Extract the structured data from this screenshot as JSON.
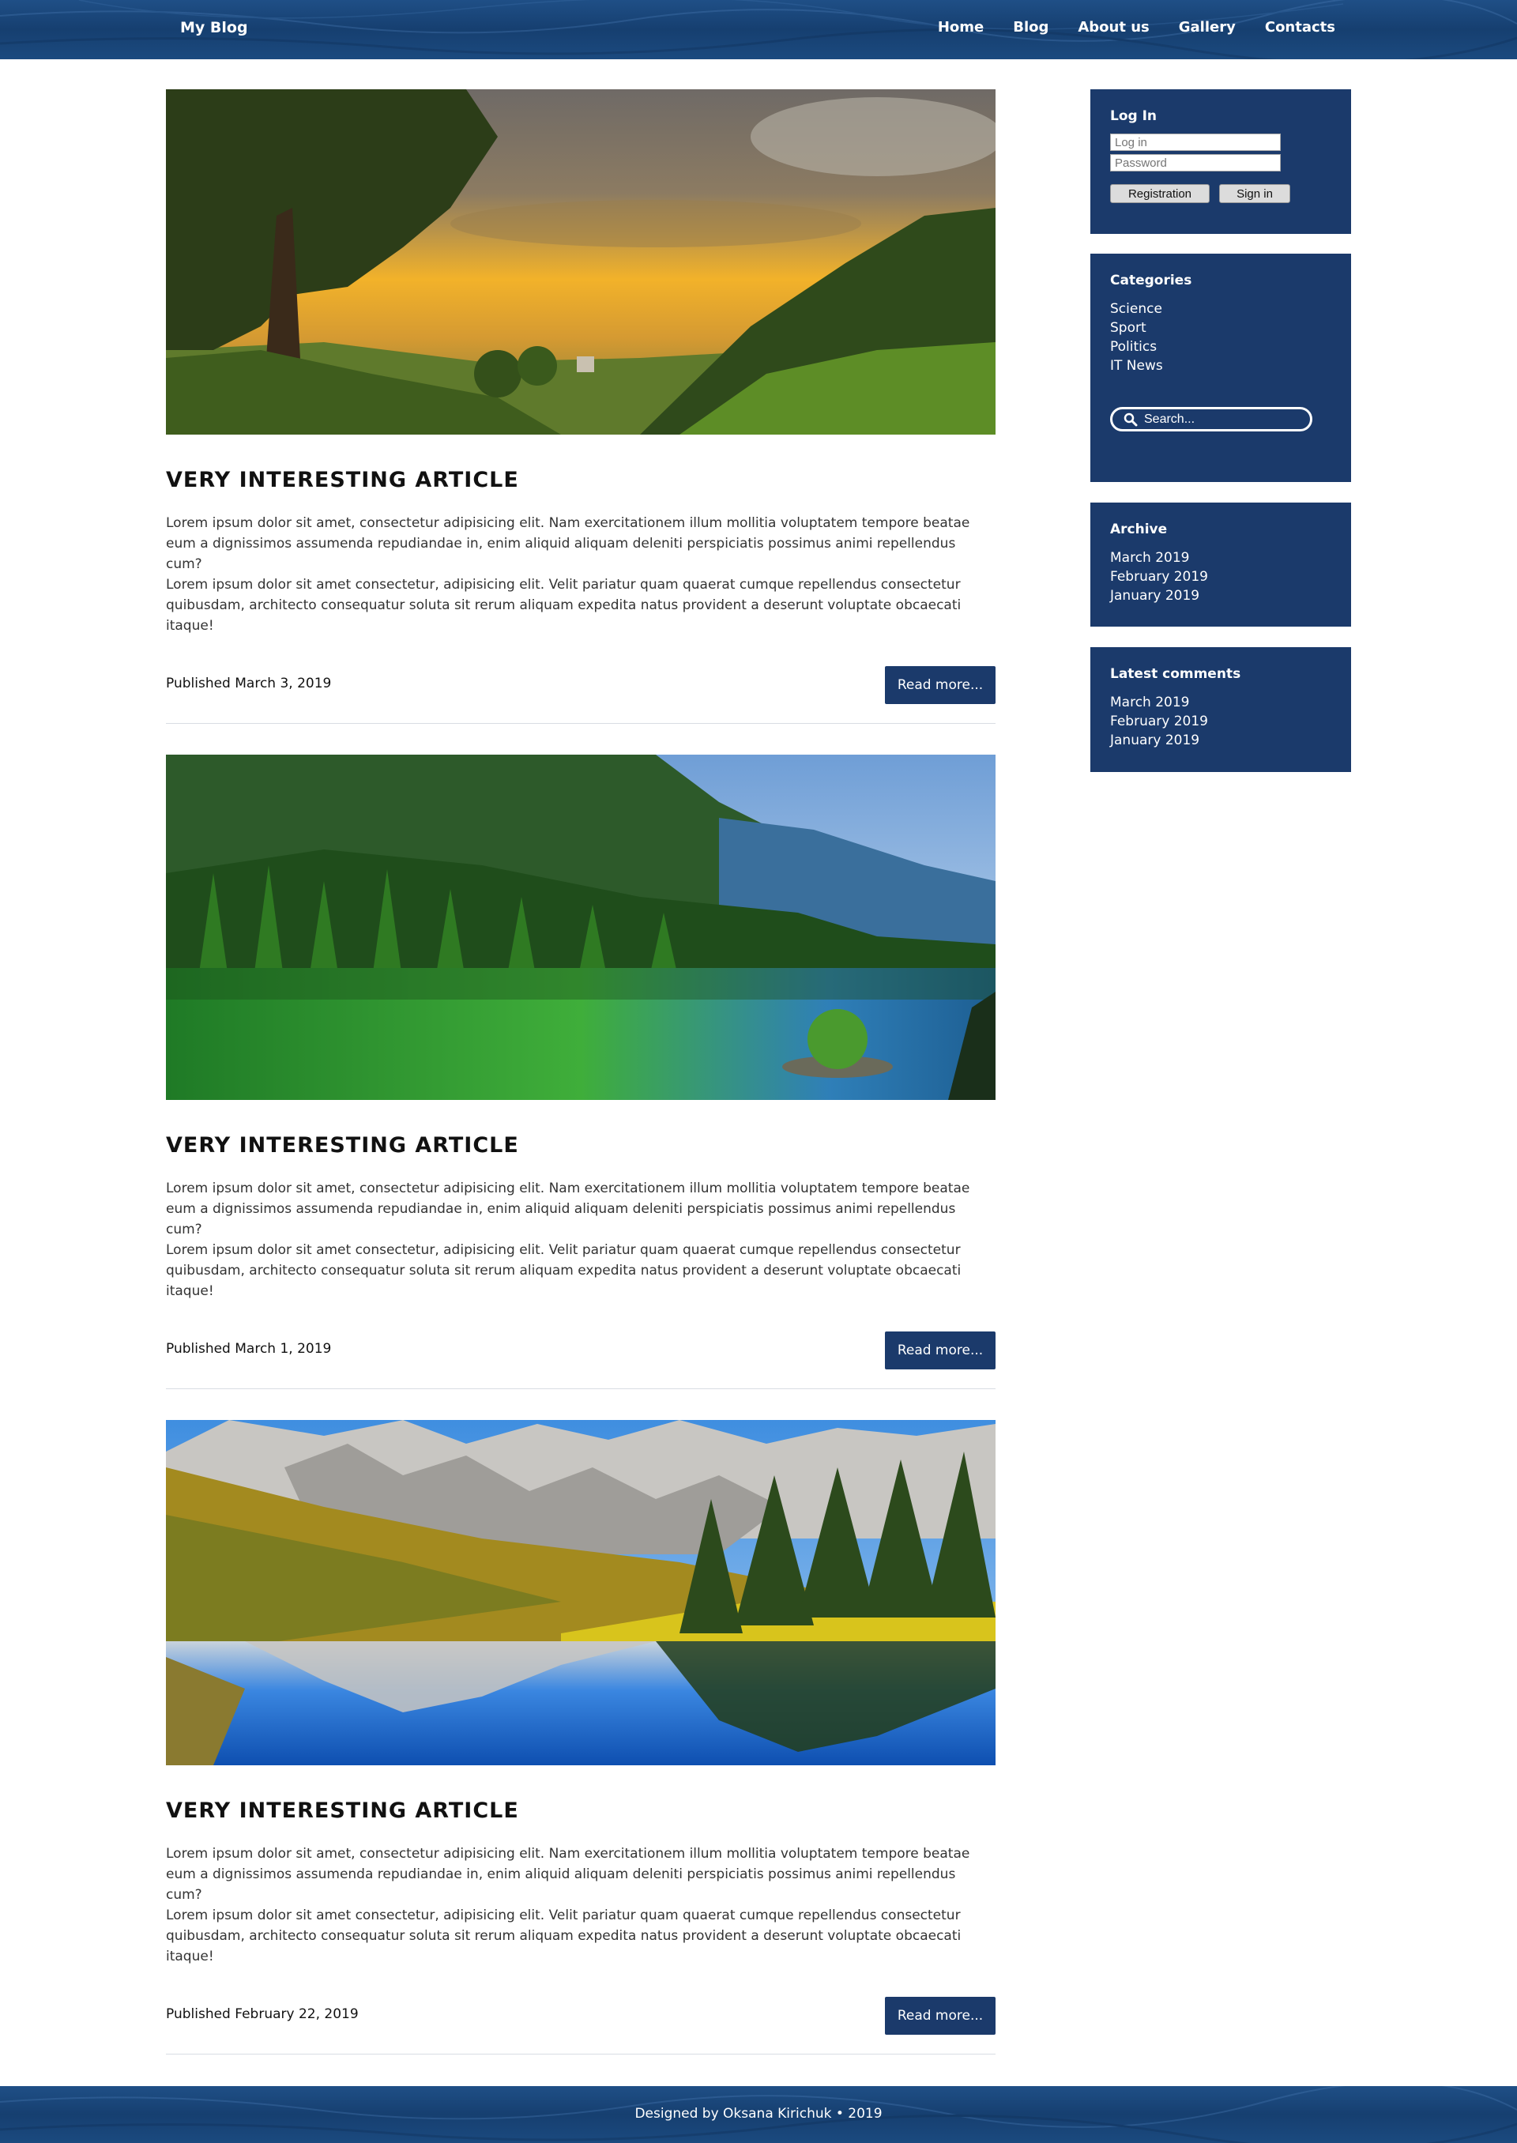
{
  "header": {
    "brand": "My Blog",
    "nav": [
      "Home",
      "Blog",
      "About us",
      "Gallery",
      "Contacts"
    ]
  },
  "posts": [
    {
      "title": "VERY INTERESTING ARTICLE",
      "excerpt_1": "Lorem ipsum dolor sit amet, consectetur adipisicing elit. Nam exercitationem illum mollitia voluptatem tempore beatae eum a dignissimos assumenda repudiandae in, enim aliquid aliquam deleniti perspiciatis possimus animi repellendus cum?",
      "excerpt_2": "Lorem ipsum dolor sit amet consectetur, adipisicing elit. Velit pariatur quam quaerat cumque repellendus consectetur quibusdam, architecto consequatur soluta sit rerum aliquam expedita natus provident a deserunt voluptate obcaecati itaque!",
      "date": "Published March 3, 2019",
      "read_more": "Read more..."
    },
    {
      "title": "VERY INTERESTING ARTICLE",
      "excerpt_1": "Lorem ipsum dolor sit amet, consectetur adipisicing elit. Nam exercitationem illum mollitia voluptatem tempore beatae eum a dignissimos assumenda repudiandae in, enim aliquid aliquam deleniti perspiciatis possimus animi repellendus cum?",
      "excerpt_2": "Lorem ipsum dolor sit amet consectetur, adipisicing elit. Velit pariatur quam quaerat cumque repellendus consectetur quibusdam, architecto consequatur soluta sit rerum aliquam expedita natus provident a deserunt voluptate obcaecati itaque!",
      "date": "Published March 1, 2019",
      "read_more": "Read more..."
    },
    {
      "title": "VERY INTERESTING ARTICLE",
      "excerpt_1": "Lorem ipsum dolor sit amet, consectetur adipisicing elit. Nam exercitationem illum mollitia voluptatem tempore beatae eum a dignissimos assumenda repudiandae in, enim aliquid aliquam deleniti perspiciatis possimus animi repellendus cum?",
      "excerpt_2": "Lorem ipsum dolor sit amet consectetur, adipisicing elit. Velit pariatur quam quaerat cumque repellendus consectetur quibusdam, architecto consequatur soluta sit rerum aliquam expedita natus provident a deserunt voluptate obcaecati itaque!",
      "date": "Published February 22, 2019",
      "read_more": "Read more..."
    }
  ],
  "sidebar": {
    "login": {
      "title": "Log In",
      "login_placeholder": "Log in",
      "password_placeholder": "Password",
      "register_label": "Registration",
      "signin_label": "Sign in"
    },
    "categories": {
      "title": "Categories",
      "items": [
        "Science",
        "Sport",
        "Politics",
        "IT News"
      ],
      "search_placeholder": "Search..."
    },
    "archive": {
      "title": "Archive",
      "items": [
        "March 2019",
        "February 2019",
        "January 2019"
      ]
    },
    "comments": {
      "title": "Latest comments",
      "items": [
        "March 2019",
        "February 2019",
        "January 2019"
      ]
    }
  },
  "footer": {
    "text": "Designed by Oksana Kirichuk • 2019"
  },
  "colors": {
    "header_blue": "#1b4a7f",
    "widget_navy": "#1b3a6b",
    "button_navy": "#1b3a6b"
  }
}
